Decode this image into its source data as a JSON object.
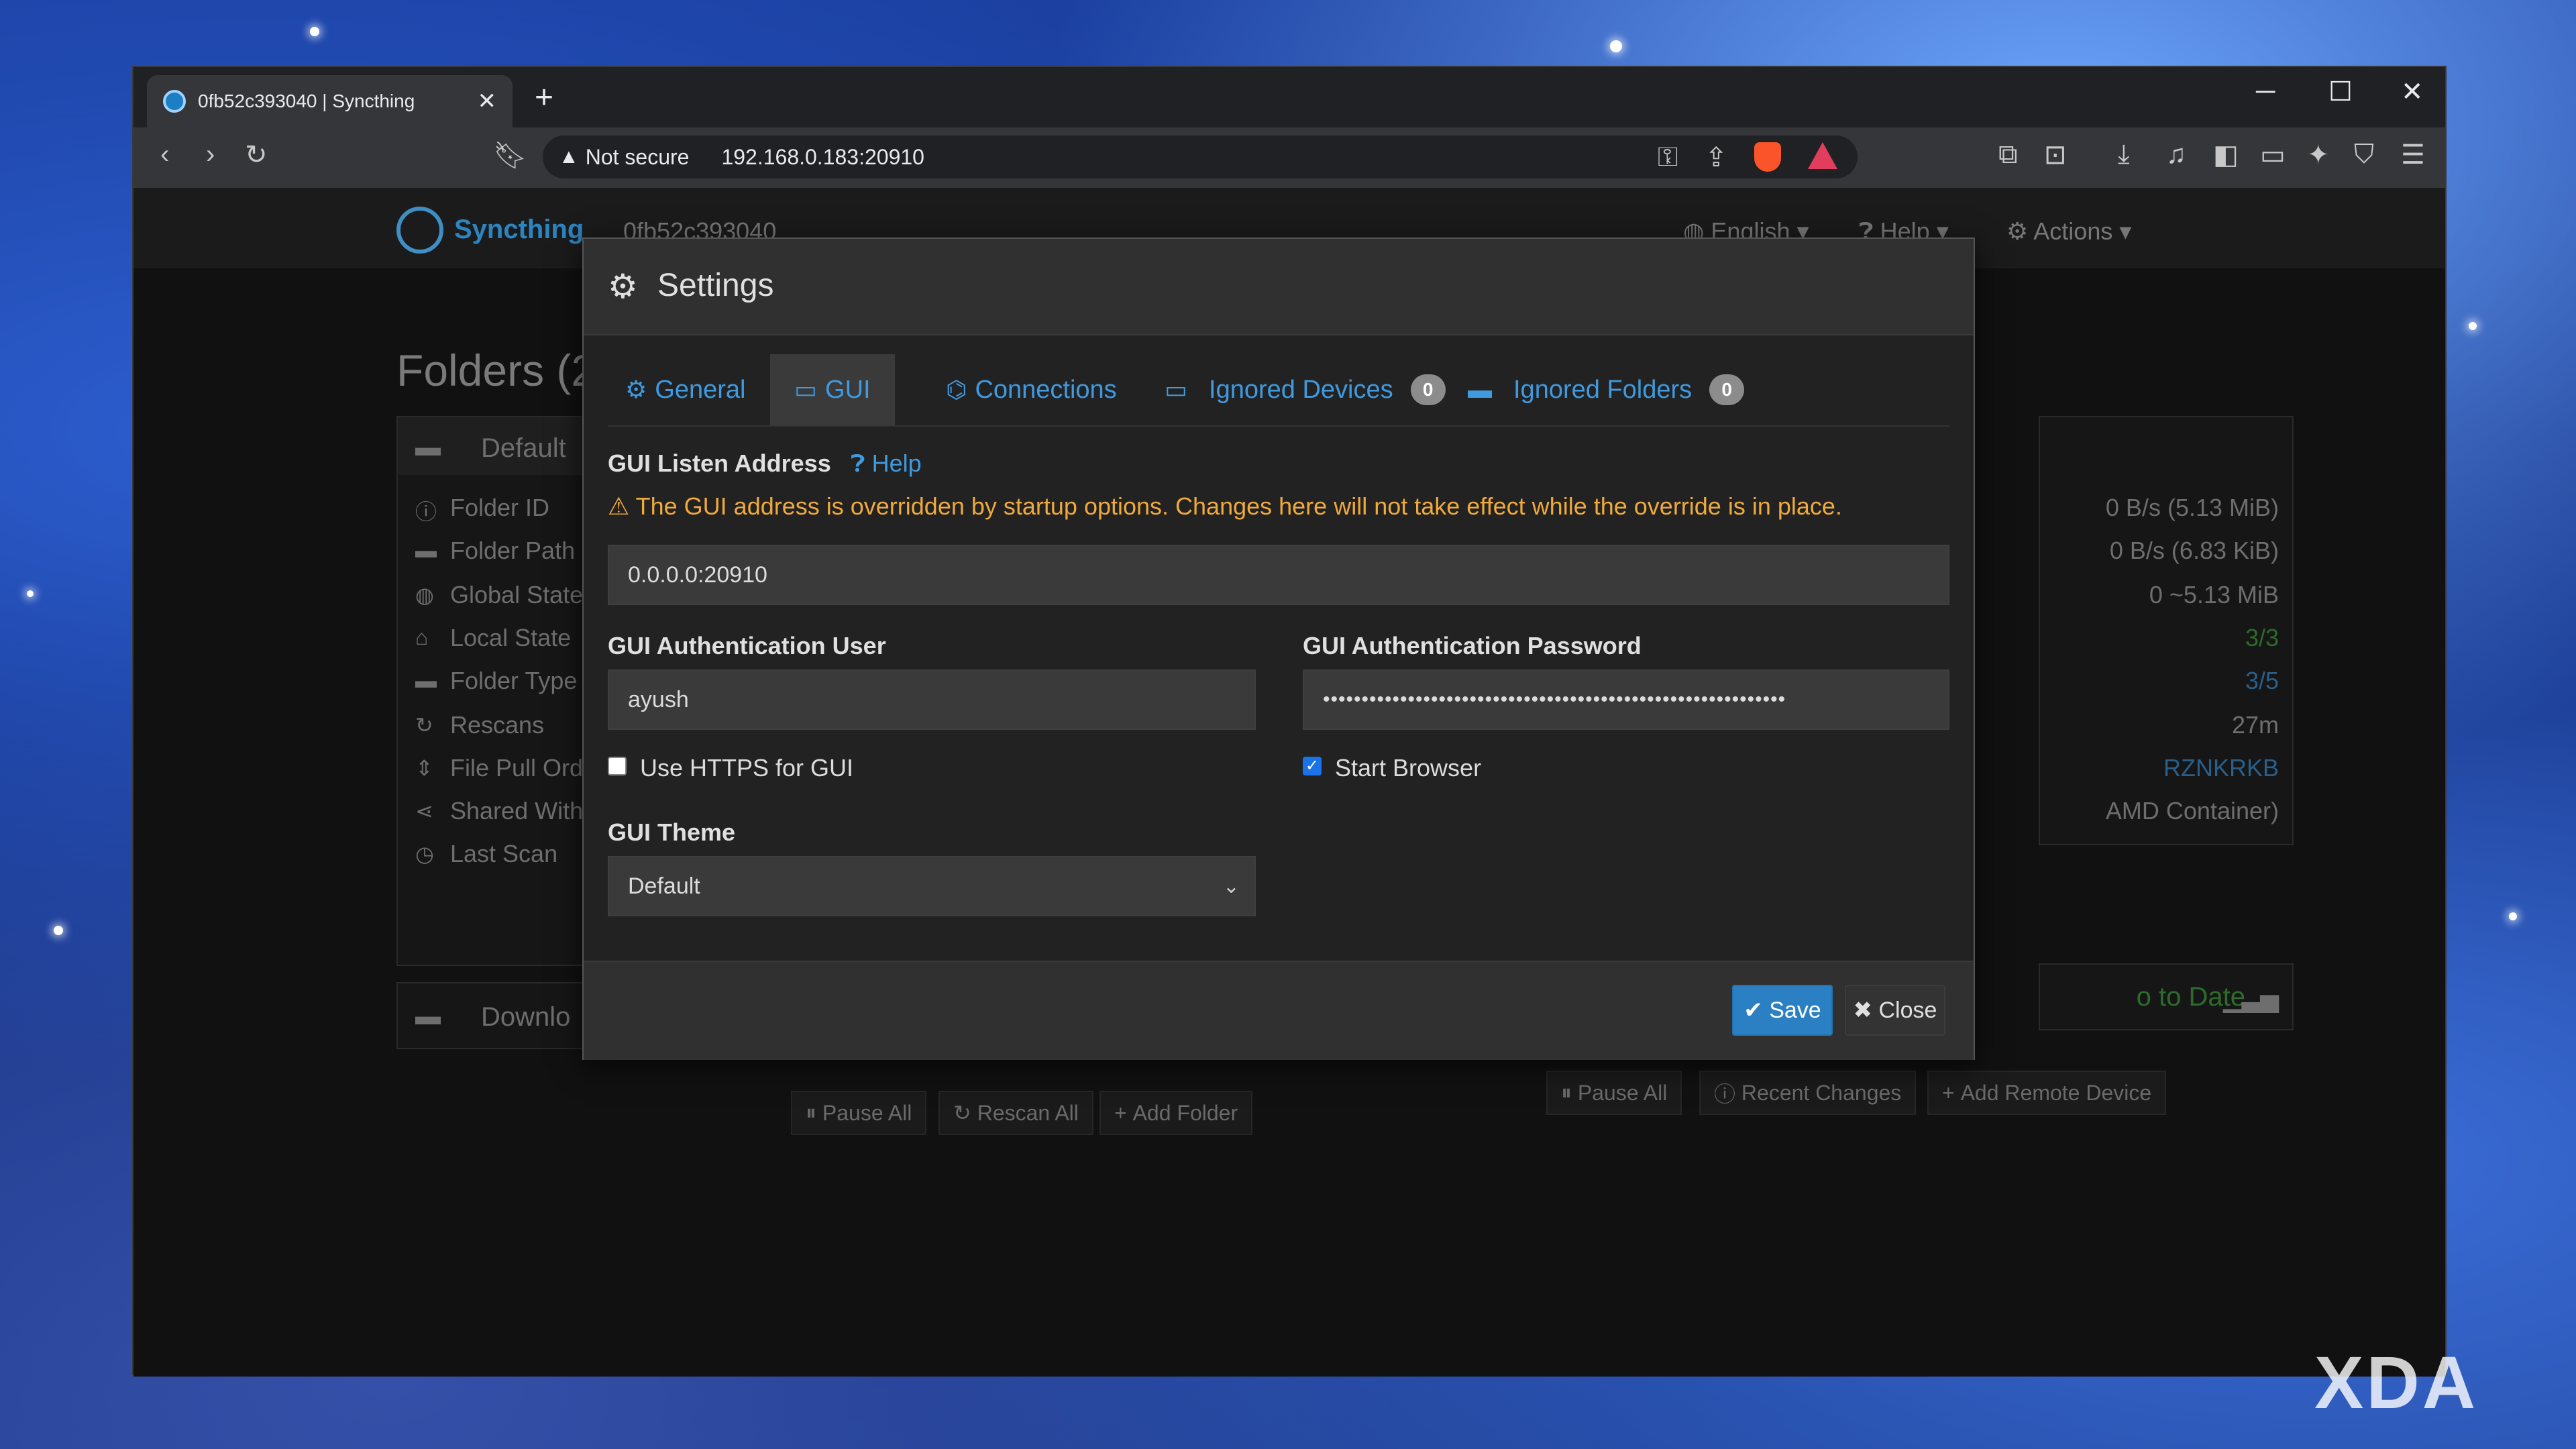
{
  "browser": {
    "tab_title": "0fb52c393040 | Syncthing",
    "not_secure": "Not secure",
    "url": "192.168.0.183:20910"
  },
  "app": {
    "brand": "Syncthing",
    "device_name": "0fb52c393040",
    "nav": {
      "language": "English",
      "help": "Help",
      "actions": "Actions"
    }
  },
  "background_page": {
    "folders_title": "Folders (2)",
    "folder1_name": "Default",
    "folder2_name": "Downlo",
    "rows": [
      {
        "label": "Folder ID",
        "icon": "info-icon",
        "value": "0 B/s (5.13 MiB)"
      },
      {
        "label": "Folder Path",
        "icon": "folder-open-icon",
        "value": "0 B/s (6.83 KiB)"
      },
      {
        "label": "Global State",
        "icon": "globe-icon",
        "value": "0  ~5.13 MiB"
      },
      {
        "label": "Local State",
        "icon": "home-icon",
        "value": "3/3"
      },
      {
        "label": "Folder Type",
        "icon": "folder-icon",
        "value": "3/5"
      },
      {
        "label": "Rescans",
        "icon": "refresh-icon",
        "value": "27m"
      },
      {
        "label": "File Pull Ord",
        "icon": "sort-icon",
        "value": "RZNKRKB"
      },
      {
        "label": "Shared With",
        "icon": "share-icon",
        "value": "AMD Container)"
      },
      {
        "label": "Last Scan",
        "icon": "clock-icon",
        "value": ""
      }
    ],
    "device_status": "o to Date",
    "folder_buttons": [
      "Pause All",
      "Rescan All",
      "Add Folder"
    ],
    "device_buttons": [
      "Pause All",
      "Recent Changes",
      "Add Remote Device"
    ]
  },
  "modal": {
    "title": "Settings",
    "tabs": [
      {
        "label": "General",
        "icon": "gear-icon"
      },
      {
        "label": "GUI",
        "icon": "monitor-icon",
        "active": true
      },
      {
        "label": "Connections",
        "icon": "network-icon"
      },
      {
        "label": "Ignored Devices",
        "icon": "laptop-icon",
        "badge": "0"
      },
      {
        "label": "Ignored Folders",
        "icon": "folder-icon",
        "badge": "0"
      }
    ],
    "listen_label": "GUI Listen Address",
    "help_label": "Help",
    "warning": "The GUI address is overridden by startup options. Changes here will not take effect while the override is in place.",
    "listen_value": "0.0.0.0:20910",
    "user_label": "GUI Authentication User",
    "user_value": "ayush",
    "password_label": "GUI Authentication Password",
    "password_value": "••••••••••••••••••••••••••••••••••••••••••••••••••••••••••••",
    "https_label": "Use HTTPS for GUI",
    "https_checked": false,
    "start_browser_label": "Start Browser",
    "start_browser_checked": true,
    "theme_label": "GUI Theme",
    "theme_value": "Default",
    "save_label": "Save",
    "close_label": "Close"
  },
  "watermark": "XDA",
  "colors": {
    "accent": "#3f9ae0",
    "warning": "#f0a93c",
    "save_button": "#2a80c2"
  }
}
